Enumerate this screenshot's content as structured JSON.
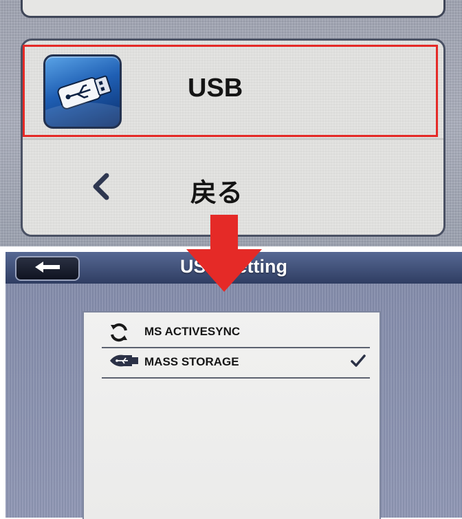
{
  "device_menu": {
    "usb_label": "USB",
    "back_label": "戻る",
    "highlight_color": "#e52a27",
    "icons": {
      "usb": "usb-icon",
      "back": "chevron-left-icon"
    }
  },
  "transition_arrow": {
    "color": "#e52a27",
    "direction": "down"
  },
  "usb_setting_screen": {
    "title": "USB Setting",
    "back_button_icon": "arrow-left-icon",
    "options": [
      {
        "label": "MS ACTIVESYNC",
        "icon": "sync-icon",
        "selected": false
      },
      {
        "label": "MASS STORAGE",
        "icon": "usb-icon",
        "selected": true
      }
    ]
  }
}
